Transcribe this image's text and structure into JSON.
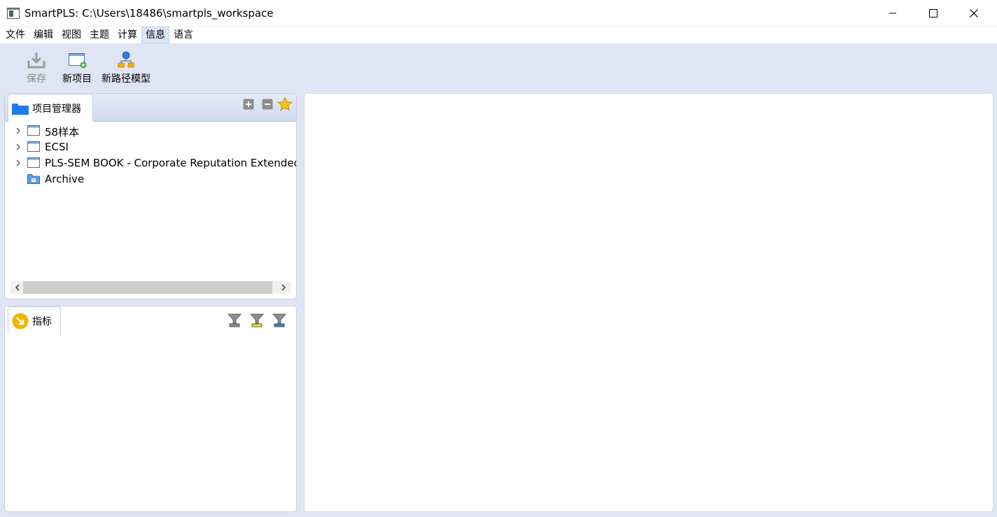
{
  "window": {
    "title": "SmartPLS: C:\\Users\\18486\\smartpls_workspace",
    "minimize": "minimize",
    "maximize": "maximize",
    "close": "close"
  },
  "menu": {
    "items": [
      "文件",
      "编辑",
      "视图",
      "主题",
      "计算",
      "信息",
      "语言"
    ],
    "active_index": 5
  },
  "toolbar": {
    "save_label": "保存",
    "new_project_label": "新项目",
    "new_path_model_label": "新路径模型"
  },
  "project_explorer": {
    "tab_label": "项目管理器",
    "items": [
      {
        "label": "58样本",
        "icon": "project-icon",
        "expandable": true
      },
      {
        "label": "ECSI",
        "icon": "project-icon",
        "expandable": true
      },
      {
        "label": "PLS-SEM BOOK - Corporate Reputation Extendec",
        "icon": "project-icon",
        "expandable": true
      },
      {
        "label": "Archive",
        "icon": "archive-folder-icon",
        "expandable": false
      }
    ]
  },
  "indicators": {
    "tab_label": "指标"
  },
  "colors": {
    "chrome_bg": "#dfe5f4",
    "folder_blue": "#1e7be8",
    "indicator_orange": "#f5b400",
    "star_yellow": "#f5c518"
  }
}
